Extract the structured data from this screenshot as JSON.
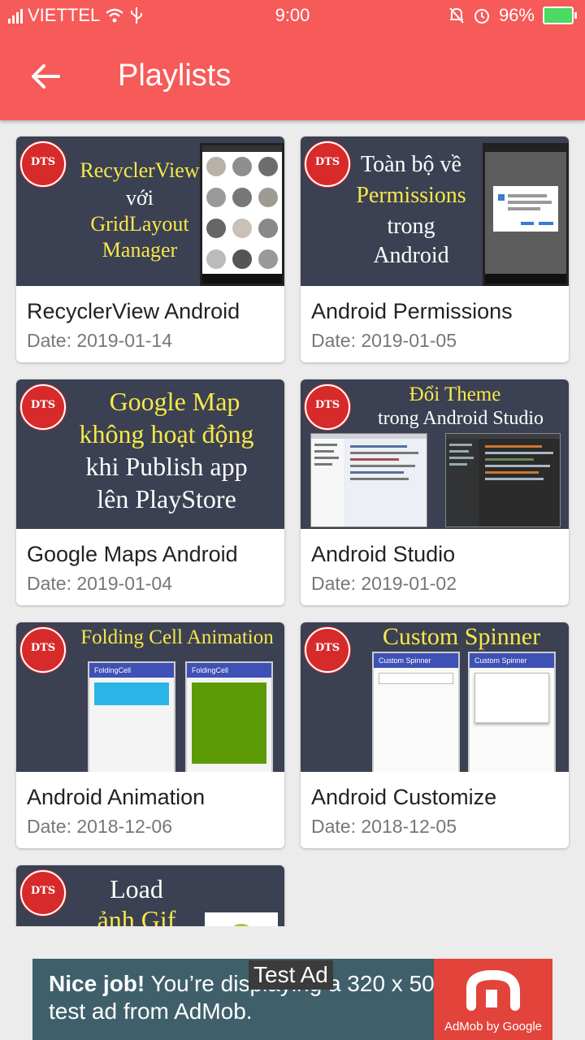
{
  "status": {
    "carrier": "VIETTEL",
    "time": "9:00",
    "battery": "96%"
  },
  "appbar": {
    "title": "Playlists"
  },
  "cards": [
    {
      "title": "RecyclerView Android",
      "date": "Date: 2019-01-14",
      "thumb": [
        "RecyclerView",
        "với",
        "GridLayout",
        "Manager"
      ]
    },
    {
      "title": "Android Permissions",
      "date": "Date: 2019-01-05",
      "thumb": [
        "Toàn bộ về",
        "Permissions",
        "trong",
        "Android"
      ]
    },
    {
      "title": "Google Maps Android",
      "date": "Date: 2019-01-04",
      "thumb": [
        "Google Map",
        "không hoạt động",
        "khi Publish app",
        "lên PlayStore"
      ]
    },
    {
      "title": "Android Studio",
      "date": "Date: 2019-01-02",
      "thumb": [
        "Đổi Theme",
        "trong Android Studio"
      ]
    },
    {
      "title": "Android Animation",
      "date": "Date: 2018-12-06",
      "thumb": [
        "Folding Cell Animation",
        "FoldingCell",
        "FoldingCell"
      ]
    },
    {
      "title": "Android Customize",
      "date": "Date: 2018-12-05",
      "thumb": [
        "Custom Spinner",
        "Custom Spinner",
        "Custom Spinner"
      ]
    },
    {
      "title": "",
      "date": "",
      "thumb": [
        "Load",
        "ảnh Gif"
      ]
    }
  ],
  "ad": {
    "lead": "Nice job!",
    "text": " You’re displaying a 320 x 50 test ad from AdMob.",
    "tag": "Test Ad",
    "brand": "AdMob by Google"
  }
}
